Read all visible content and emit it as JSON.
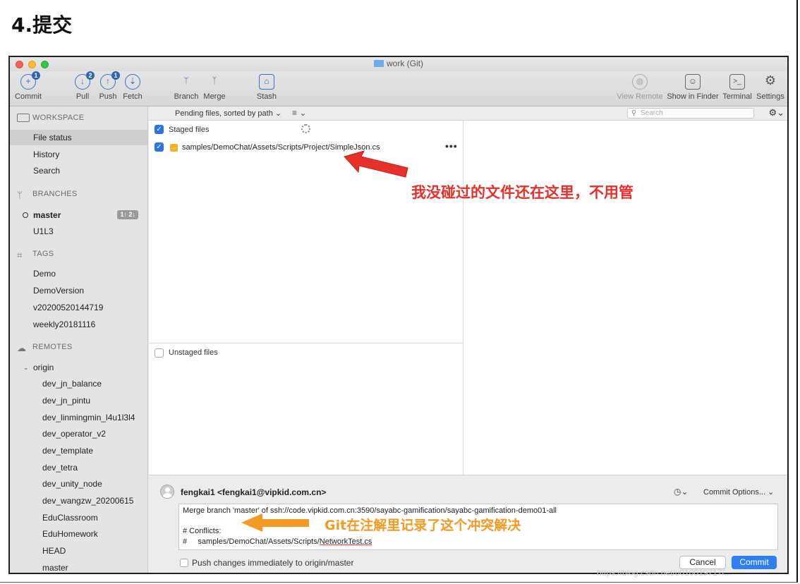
{
  "doc": {
    "title": "4.提交"
  },
  "window": {
    "title": "work (Git)"
  },
  "toolbar": {
    "commit": {
      "label": "Commit",
      "badge": "1"
    },
    "pull": {
      "label": "Pull",
      "badge": "2"
    },
    "push": {
      "label": "Push",
      "badge": "1"
    },
    "fetch": {
      "label": "Fetch"
    },
    "branch": {
      "label": "Branch"
    },
    "merge": {
      "label": "Merge"
    },
    "stash": {
      "label": "Stash"
    },
    "view_remote": {
      "label": "View Remote"
    },
    "show_in_finder": {
      "label": "Show in Finder"
    },
    "terminal": {
      "label": "Terminal"
    },
    "settings": {
      "label": "Settings"
    }
  },
  "sidebar": {
    "workspace": {
      "title": "WORKSPACE",
      "items": [
        "File status",
        "History",
        "Search"
      ]
    },
    "branches": {
      "title": "BRANCHES",
      "current": "master",
      "current_badge": "1↑ 2↓",
      "items": [
        "U1L3"
      ]
    },
    "tags": {
      "title": "TAGS",
      "items": [
        "Demo",
        "DemoVersion",
        "v20200520144719",
        "weekly20181116"
      ]
    },
    "remotes": {
      "title": "REMOTES",
      "origin": "origin",
      "items": [
        "dev_jn_balance",
        "dev_jn_pintu",
        "dev_linmingmin_l4u1l3l4",
        "dev_operator_v2",
        "dev_template",
        "dev_tetra",
        "dev_unity_node",
        "dev_wangzw_20200615",
        "EduClassroom",
        "EduHomework",
        "HEAD",
        "master"
      ]
    }
  },
  "main": {
    "filter_label": "Pending files, sorted by path ⌄",
    "list_menu": "≡ ⌄",
    "search_placeholder": "Search",
    "staged_label": "Staged files",
    "staged_file": "samples/DemoChat/Assets/Scripts/Project/SimpleJson.cs",
    "unstaged_label": "Unstaged files"
  },
  "commit": {
    "author": "fengkai1 <fengkai1@vipkid.com.cn>",
    "options_label": "Commit Options... ⌄",
    "message_line1": "Merge branch 'master' of ssh://code.vipkid.com.cn:3590/sayabc-gamification/sayabc-gamification-demo01-all",
    "message_line2": "# Conflicts:",
    "message_line3_prefix": "#     samples/DemoChat/Assets/Scripts/",
    "message_line3_file": "NetworkTest.cs",
    "push_label": "Push changes immediately to origin/master",
    "cancel_label": "Cancel",
    "commit_label": "Commit"
  },
  "annotations": {
    "red": "我没碰过的文件还在这里，不用管",
    "orange": "Git在注解里记录了这个冲突解决"
  },
  "watermark": "https://blog.csdn.net/u010019717/...",
  "colors": {
    "accent": "#2f7ef2",
    "annotation_red": "#e8302a",
    "annotation_orange": "#f39a22",
    "modified": "#f4b125"
  }
}
